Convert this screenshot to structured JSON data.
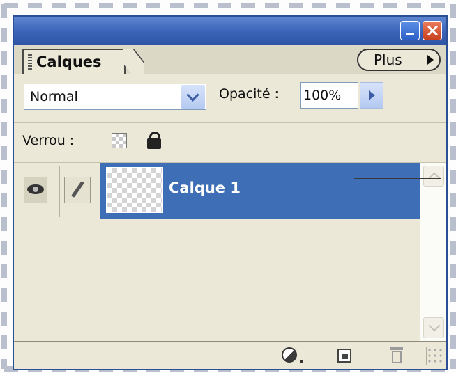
{
  "panel": {
    "tab_label": "Calques",
    "more_button_label": "Plus"
  },
  "options": {
    "blend_mode": "Normal",
    "opacity_label": "Opacité :",
    "opacity_value": "100%"
  },
  "lock": {
    "label": "Verrou :"
  },
  "layers": [
    {
      "name": "Calque 1",
      "visible": true,
      "selected": true
    }
  ],
  "icons": {
    "minimize": "minimize-icon",
    "close": "close-icon",
    "visibility": "eye-icon",
    "brush": "brush-icon",
    "lock_transparent": "checkerboard-lock-icon",
    "lock_all": "padlock-icon",
    "new_adjustment": "half-circle-icon",
    "new_layer": "new-layer-icon",
    "trash": "trash-icon"
  },
  "colors": {
    "title_bar": "#3b63b8",
    "selected_layer": "#3d6eb6",
    "panel_background": "#ece8d8",
    "close_button": "#c8401f"
  }
}
